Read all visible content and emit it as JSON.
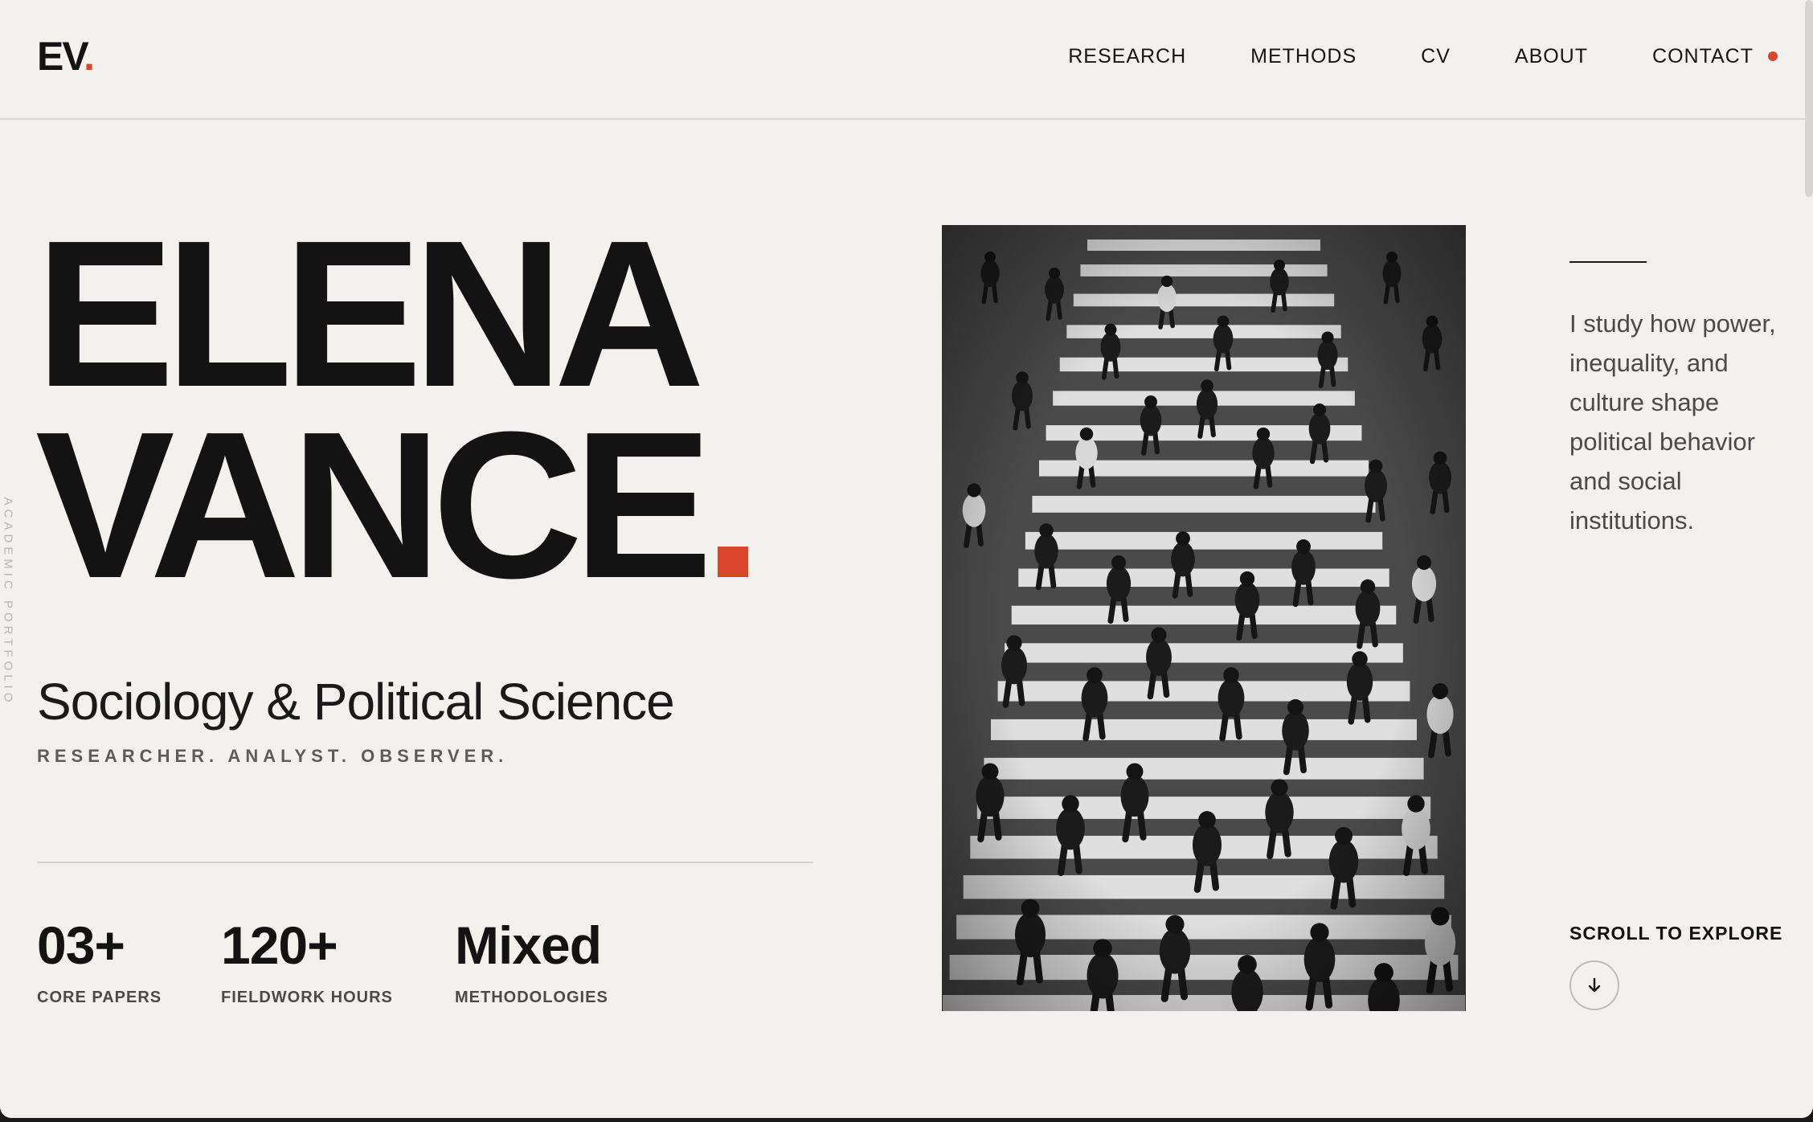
{
  "header": {
    "logo_text": "EV",
    "logo_dot": ".",
    "nav": [
      "RESEARCH",
      "METHODS",
      "CV",
      "ABOUT"
    ],
    "contact_label": "CONTACT"
  },
  "side_text": "ACADEMIC PORTFOLIO",
  "hero": {
    "first_name": "ELENA",
    "last_name": "VANCE",
    "subtitle": "Sociology & Political Science",
    "tagline": "RESEARCHER. ANALYST. OBSERVER."
  },
  "stats": [
    {
      "value": "03+",
      "label": "CORE PAPERS"
    },
    {
      "value": "120+",
      "label": "FIELDWORK HOURS"
    },
    {
      "value": "Mixed",
      "label": "METHODOLOGIES"
    }
  ],
  "bio": "I study how power, inequality, and culture shape political behavior and social institutions.",
  "scroll": {
    "label": "SCROLL TO EXPLORE",
    "icon": "arrow-down-icon"
  },
  "colors": {
    "accent": "#d9462c",
    "background": "#f2f1ed",
    "text": "#131313"
  }
}
